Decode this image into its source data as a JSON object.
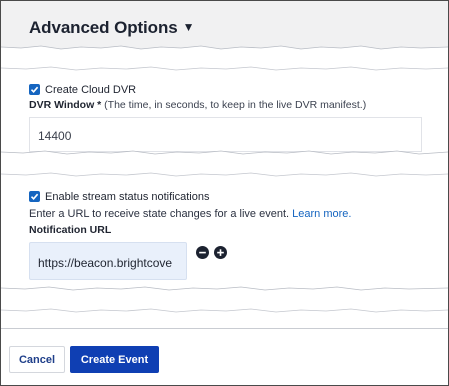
{
  "section": {
    "title": "Advanced Options",
    "caret_glyph": "▼"
  },
  "dvr": {
    "checkbox_label": "Create Cloud DVR",
    "checked": true,
    "window_label": "DVR Window *",
    "window_hint": "(The time, in seconds, to keep in the live DVR manifest.)",
    "window_value": "14400"
  },
  "notifications": {
    "checkbox_label": "Enable stream status notifications",
    "checked": true,
    "help_text": "Enter a URL to receive state changes for a live event.",
    "learn_more": "Learn more.",
    "url_label": "Notification URL",
    "url_value": "https://beacon.brightcove"
  },
  "footer": {
    "cancel_label": "Cancel",
    "create_label": "Create Event"
  },
  "colors": {
    "accent": "#1565c0",
    "primary_button": "#0f3fb3",
    "header_bg": "#f1f1f2",
    "url_input_bg": "#e9f0fb"
  },
  "icons": [
    "caret-down-icon",
    "checkmark-icon",
    "minus-circle-icon",
    "plus-circle-icon"
  ]
}
